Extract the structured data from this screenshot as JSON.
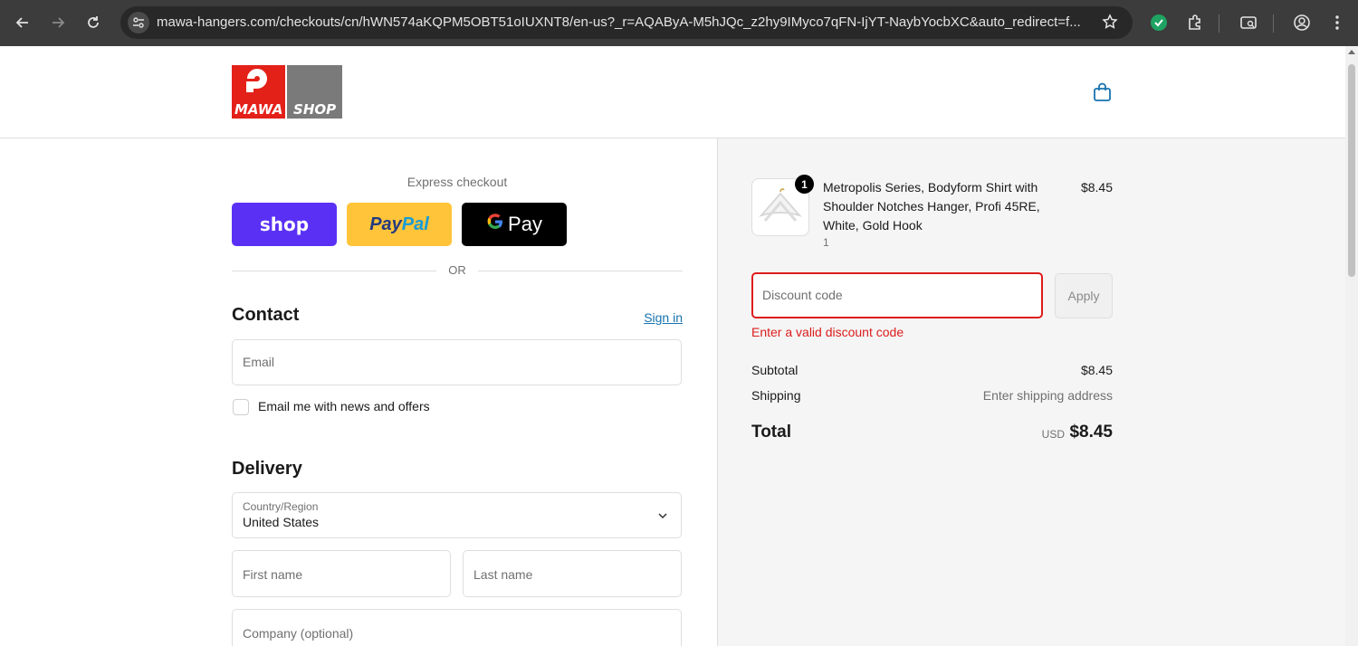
{
  "browser": {
    "url": "mawa-hangers.com/checkouts/cn/hWN574aKQPM5OBT51oIUXNT8/en-us?_r=AQAByA-M5hJQc_z2hy9IMyco7qFN-IjYT-NaybYocbXC&auto_redirect=f..."
  },
  "header": {
    "logo_left": "MAWA",
    "logo_right": "SHOP"
  },
  "express": {
    "label": "Express checkout",
    "shop_label": "shop",
    "paypal_a": "Pay",
    "paypal_b": "Pal",
    "gpay_g": "G",
    "gpay_label": "Pay",
    "or": "OR"
  },
  "contact": {
    "title": "Contact",
    "signin": "Sign in",
    "email_placeholder": "Email",
    "newsletter_label": "Email me with news and offers"
  },
  "delivery": {
    "title": "Delivery",
    "country_label": "Country/Region",
    "country_value": "United States",
    "first_name_placeholder": "First name",
    "last_name_placeholder": "Last name",
    "company_placeholder": "Company (optional)"
  },
  "cart": {
    "item_name": "Metropolis Series, Bodyform Shirt with Shoulder Notches Hanger, Profi 45RE, White, Gold Hook",
    "item_qty": "1",
    "item_badge": "1",
    "item_price": "$8.45"
  },
  "discount": {
    "placeholder": "Discount code",
    "apply_label": "Apply",
    "error": "Enter a valid discount code"
  },
  "summary": {
    "subtotal_label": "Subtotal",
    "subtotal_value": "$8.45",
    "shipping_label": "Shipping",
    "shipping_value": "Enter shipping address",
    "total_label": "Total",
    "currency": "USD",
    "total_value": "$8.45"
  },
  "colors": {
    "shop_pay": "#5a31f4",
    "paypal": "#ffc439",
    "error": "#dd1d1d",
    "link": "#1773b0"
  }
}
